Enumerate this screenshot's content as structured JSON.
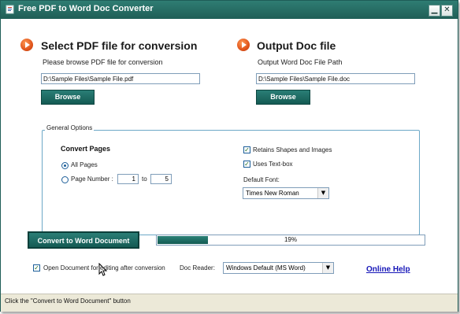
{
  "window": {
    "title": "Free PDF to Word Doc Converter",
    "minimize_glyph": "▁",
    "close_glyph": "✕"
  },
  "source": {
    "heading": "Select PDF file for conversion",
    "caption": "Please browse PDF file for conversion",
    "path_value": "D:\\Sample Files\\Sample File.pdf",
    "browse_label": "Browse"
  },
  "output": {
    "heading": "Output Doc file",
    "caption": "Output Word Doc File Path",
    "path_value": "D:\\Sample Files\\Sample File.doc",
    "browse_label": "Browse"
  },
  "options": {
    "legend": "General Options",
    "convert_pages_label": "Convert Pages",
    "all_pages_label": "All Pages",
    "page_number_label": "Page Number :",
    "page_from": "1",
    "to_label": "to",
    "page_to": "5",
    "retain_shapes_label": "Retains Shapes and Images",
    "retain_shapes_checked": true,
    "uses_textbox_label": "Uses Text-box",
    "uses_textbox_checked": true,
    "default_font_label": "Default Font:",
    "default_font_value": "Times New Roman"
  },
  "actions": {
    "convert_label": "Convert to Word Document",
    "progress_text": "19%",
    "progress_fraction": 0.19
  },
  "footer": {
    "open_after_label": "Open Document for editing after conversion",
    "open_after_checked": true,
    "doc_reader_label": "Doc Reader:",
    "doc_reader_value": "Windows Default (MS Word)",
    "help_label": "Online Help"
  },
  "status": {
    "text": "Click the \"Convert to Word Document\" button"
  },
  "colors": {
    "accent": "#1f6e66",
    "link": "#1616b8"
  }
}
